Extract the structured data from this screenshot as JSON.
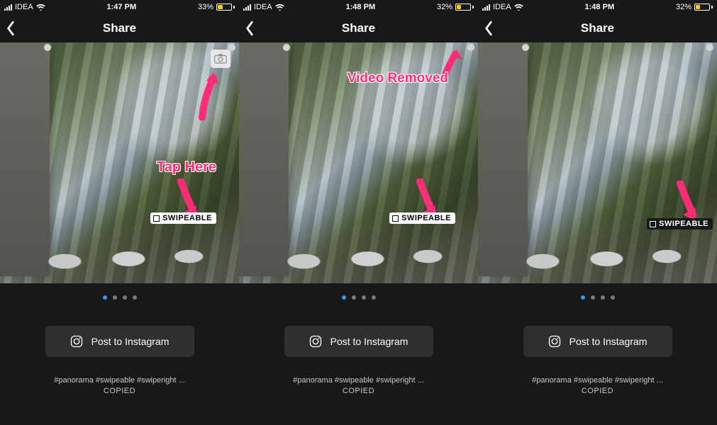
{
  "screens": [
    {
      "status": {
        "carrier": "IDEA",
        "time": "1:47 PM",
        "battery_pct": "33%",
        "battery_fill_pct": 33
      },
      "nav": {
        "title": "Share"
      },
      "annotation": {
        "text": "Tap Here",
        "kind": "tap"
      },
      "show_camera_icon": true,
      "swipeable": {
        "label": "SWIPEABLE",
        "variant": "light"
      },
      "pager": {
        "active": 0,
        "count": 4
      },
      "post_button": "Post to Instagram",
      "hashtags": "#panorama #swipeable #swiperight ...",
      "copied": "COPIED"
    },
    {
      "status": {
        "carrier": "IDEA",
        "time": "1:48 PM",
        "battery_pct": "32%",
        "battery_fill_pct": 32
      },
      "nav": {
        "title": "Share"
      },
      "annotation": {
        "text": "Video Removed",
        "kind": "removed"
      },
      "show_camera_icon": false,
      "swipeable": {
        "label": "SWIPEABLE",
        "variant": "light"
      },
      "pager": {
        "active": 0,
        "count": 4
      },
      "post_button": "Post to Instagram",
      "hashtags": "#panorama #swipeable #swiperight ...",
      "copied": "COPIED"
    },
    {
      "status": {
        "carrier": "IDEA",
        "time": "1:48 PM",
        "battery_pct": "32%",
        "battery_fill_pct": 32
      },
      "nav": {
        "title": "Share"
      },
      "annotation": null,
      "show_camera_icon": false,
      "swipeable": {
        "label": "SWIPEABLE",
        "variant": "dark"
      },
      "pager": {
        "active": 0,
        "count": 4
      },
      "post_button": "Post to Instagram",
      "hashtags": "#panorama #swipeable #swiperight ...",
      "copied": "COPIED"
    }
  ],
  "arrows": {
    "top_right": true,
    "down_to_tag": true
  }
}
